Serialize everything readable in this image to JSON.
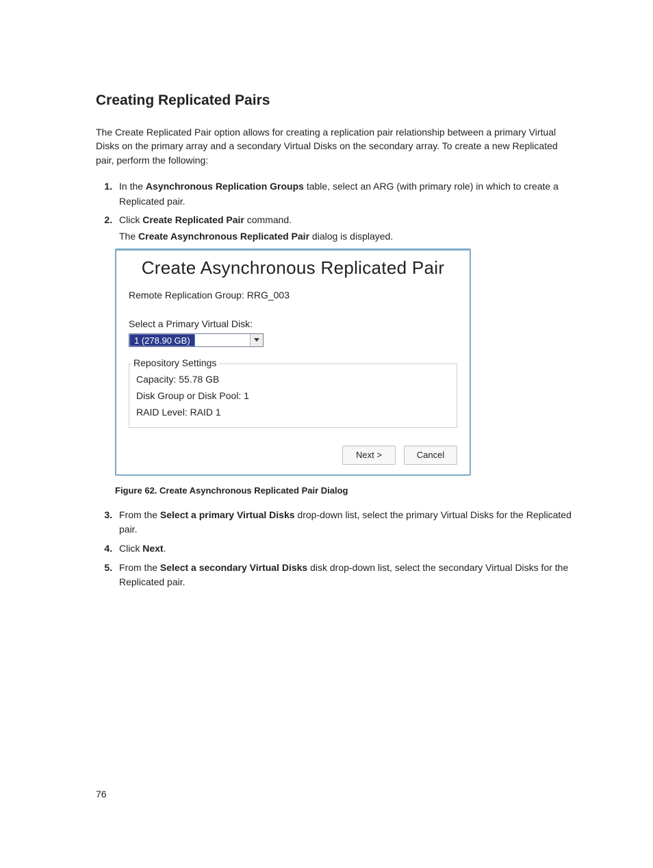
{
  "section": {
    "title": "Creating Replicated Pairs",
    "intro": "The Create Replicated Pair option allows for creating a replication pair relationship between a primary Virtual Disks on the primary array and a secondary Virtual Disks on the secondary array. To create a new Replicated pair, perform the following:",
    "steps": {
      "s1_pre": "In the ",
      "s1_bold": "Asynchronous Replication Groups",
      "s1_post": " table, select an ARG (with primary role) in which to create a Replicated pair.",
      "s2_pre": "Click ",
      "s2_bold": "Create Replicated Pair",
      "s2_post": " command.",
      "s2b_pre": "The ",
      "s2b_bold": "Create Asynchronous Replicated Pair",
      "s2b_post": " dialog is displayed.",
      "s3_pre": "From the ",
      "s3_bold": "Select a primary Virtual Disks",
      "s3_post": " drop-down list, select the primary Virtual Disks for the Replicated pair.",
      "s4_pre": "Click ",
      "s4_bold": "Next",
      "s4_post": ".",
      "s5_pre": "From the ",
      "s5_bold": "Select a secondary Virtual Disks",
      "s5_post": " disk drop-down list, select the secondary Virtual Disks for the Replicated pair."
    },
    "figure_caption": "Figure 62. Create Asynchronous Replicated Pair Dialog"
  },
  "dialog": {
    "title": "Create Asynchronous Replicated Pair",
    "remote_group_label": "Remote Replication Group: RRG_003",
    "select_primary_label": "Select a Primary Virtual Disk:",
    "dropdown_value": "1 (278.90 GB)",
    "repo_legend": "Repository Settings",
    "capacity_row": "Capacity:  55.78 GB",
    "diskgroup_row": "Disk Group or Disk Pool:  1",
    "raid_row": "RAID Level:  RAID 1",
    "next_btn": "Next >",
    "cancel_btn": "Cancel"
  },
  "page_number": "76"
}
